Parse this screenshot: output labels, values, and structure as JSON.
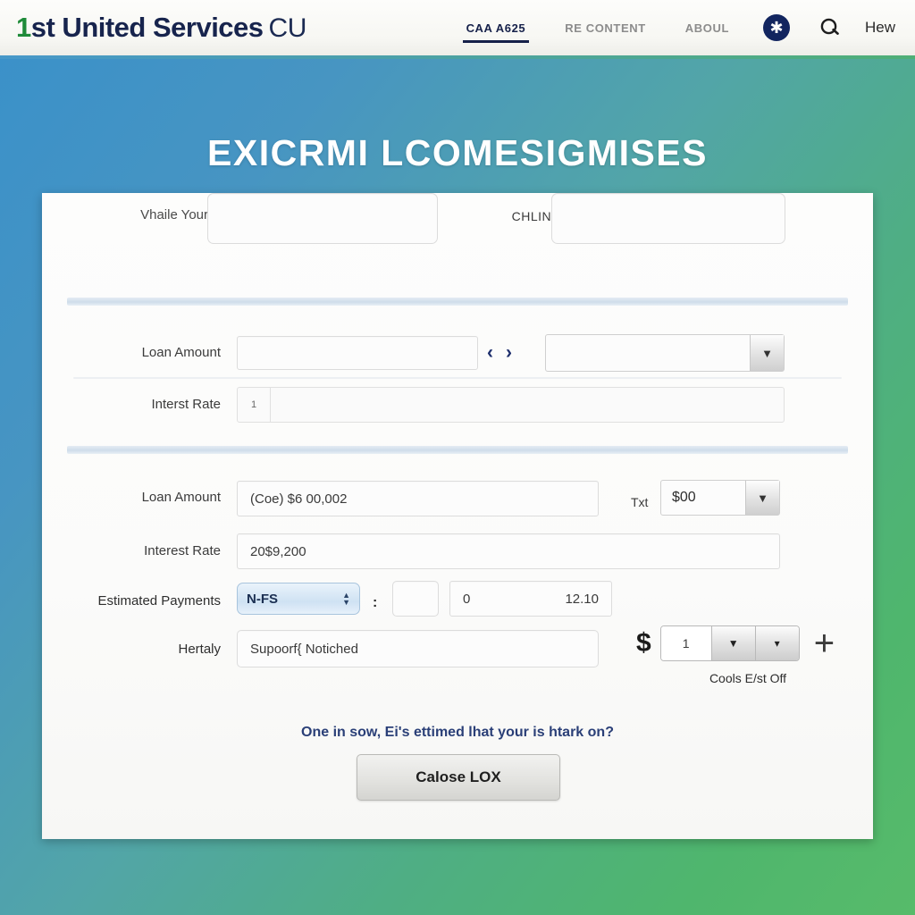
{
  "header": {
    "logo": {
      "prefix": "1",
      "main": "st United Services",
      "suffix": "CU"
    },
    "nav": [
      {
        "label": "CAA A625",
        "active": true
      },
      {
        "label": "RE CONTENT",
        "active": false
      },
      {
        "label": "ABOUL",
        "active": false
      }
    ],
    "badge_glyph": "✱",
    "right_label": "Hew"
  },
  "page": {
    "title": "EXICRMI LCOMESIGMISES"
  },
  "form": {
    "row1": {
      "label_a": "Vhaile Your",
      "value_a": "",
      "label_b": "CHLINE",
      "value_b": ""
    },
    "row2": {
      "label": "Loan Amount",
      "value": "",
      "prev_glyph": "‹",
      "next_glyph": "›",
      "select_value": "",
      "select_arrow": "▼"
    },
    "row3": {
      "label": "Interst Rate",
      "prefix": "1",
      "value": ""
    },
    "row4": {
      "label": "Loan Amount",
      "value": "(Coe) $6 00,002",
      "side_label": "Txt",
      "select_value": "$00",
      "select_arrow": "▼"
    },
    "row5": {
      "label": "Interest Rate",
      "value": "20$9,200"
    },
    "row6": {
      "label": "Estimated Payments",
      "select_value": "N-FS",
      "separator": ":",
      "small_value": "",
      "field_left": "0",
      "field_right": "12.10"
    },
    "row7": {
      "label": "Hertaly",
      "value": "Supoorf{ Notiched",
      "currency": "$",
      "spin_value": "1",
      "arrow_down": "▼",
      "arrow_small": "▾",
      "plus": "+",
      "caption": "Cools E/st Off"
    }
  },
  "footer": {
    "note": "One in sow, Ei's ettimed lhat your is htark on?",
    "button": "Calose LOX"
  }
}
